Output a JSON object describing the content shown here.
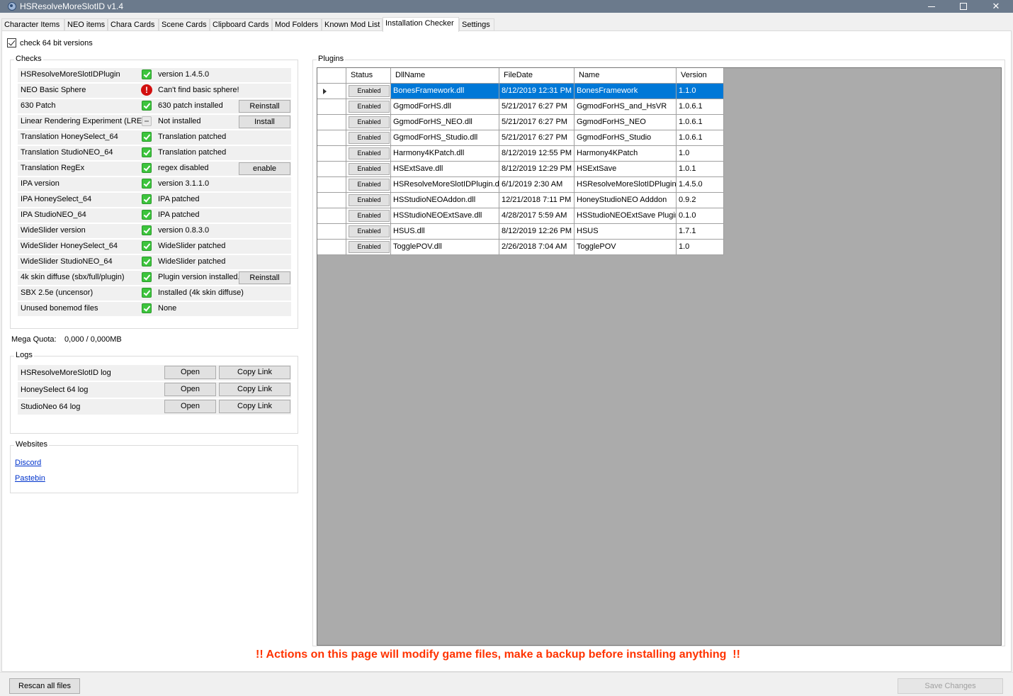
{
  "window": {
    "title": "HSResolveMoreSlotID v1.4"
  },
  "tabs": [
    {
      "label": "Character Items"
    },
    {
      "label": "NEO items"
    },
    {
      "label": "Chara Cards"
    },
    {
      "label": "Scene Cards"
    },
    {
      "label": "Clipboard Cards"
    },
    {
      "label": "Mod Folders"
    },
    {
      "label": "Known Mod List"
    },
    {
      "label": "Installation Checker",
      "active": true
    },
    {
      "label": "Settings"
    }
  ],
  "options": {
    "check64_label": "check 64 bit versions",
    "check64_checked": true
  },
  "checks": {
    "legend": "Checks",
    "rows": [
      {
        "label": "HSResolveMoreSlotIDPlugin",
        "icon": "ok",
        "status": "version 1.4.5.0"
      },
      {
        "label": "NEO Basic Sphere",
        "icon": "error",
        "status": "Can't find basic sphere!"
      },
      {
        "label": "630 Patch",
        "icon": "ok",
        "status": "630 patch installed",
        "action": "Reinstall"
      },
      {
        "label": "Linear Rendering Experiment (LRE)",
        "icon": "none",
        "status": "Not installed",
        "action": "Install"
      },
      {
        "label": "Translation HoneySelect_64",
        "icon": "ok",
        "status": "Translation patched"
      },
      {
        "label": "Translation StudioNEO_64",
        "icon": "ok",
        "status": "Translation patched"
      },
      {
        "label": "Translation RegEx",
        "icon": "ok",
        "status": "regex disabled",
        "action": "enable"
      },
      {
        "label": "IPA version",
        "icon": "ok",
        "status": "version 3.1.1.0"
      },
      {
        "label": "IPA HoneySelect_64",
        "icon": "ok",
        "status": "IPA patched"
      },
      {
        "label": "IPA StudioNEO_64",
        "icon": "ok",
        "status": "IPA patched"
      },
      {
        "label": "WideSlider version",
        "icon": "ok",
        "status": "version 0.8.3.0"
      },
      {
        "label": "WideSlider HoneySelect_64",
        "icon": "ok",
        "status": "WideSlider patched"
      },
      {
        "label": "WideSlider StudioNEO_64",
        "icon": "ok",
        "status": "WideSlider patched"
      },
      {
        "label": "4k skin diffuse (sbx/full/plugin)",
        "icon": "ok",
        "status": "Plugin version installed.",
        "action": "Reinstall"
      },
      {
        "label": "SBX 2.5e (uncensor)",
        "icon": "ok",
        "status": "Installed (4k skin diffuse)"
      },
      {
        "label": "Unused bonemod files",
        "icon": "ok",
        "status": "None"
      }
    ]
  },
  "mega_quota": {
    "label": "Mega Quota:",
    "value": "0,000 / 0,000MB"
  },
  "logs": {
    "legend": "Logs",
    "rows": [
      {
        "label": "HSResolveMoreSlotID log",
        "open": "Open",
        "copy": "Copy Link"
      },
      {
        "label": "HoneySelect 64 log",
        "open": "Open",
        "copy": "Copy Link"
      },
      {
        "label": "StudioNeo 64 log",
        "open": "Open",
        "copy": "Copy Link"
      }
    ]
  },
  "websites": {
    "legend": "Websites",
    "links": [
      {
        "label": "Discord"
      },
      {
        "label": "Pastebin"
      }
    ]
  },
  "plugins": {
    "legend": "Plugins",
    "columns": [
      "Status",
      "DllName",
      "FileDate",
      "Name",
      "Version"
    ],
    "rows": [
      {
        "status": "Enabled",
        "dll": "BonesFramework.dll",
        "date": "8/12/2019 12:31 PM",
        "name": "BonesFramework",
        "version": "1.1.0"
      },
      {
        "status": "Enabled",
        "dll": "GgmodForHS.dll",
        "date": "5/21/2017 6:27 PM",
        "name": "GgmodForHS_and_HsVR",
        "version": "1.0.6.1"
      },
      {
        "status": "Enabled",
        "dll": "GgmodForHS_NEO.dll",
        "date": "5/21/2017 6:27 PM",
        "name": "GgmodForHS_NEO",
        "version": "1.0.6.1"
      },
      {
        "status": "Enabled",
        "dll": "GgmodForHS_Studio.dll",
        "date": "5/21/2017 6:27 PM",
        "name": "GgmodForHS_Studio",
        "version": "1.0.6.1"
      },
      {
        "status": "Enabled",
        "dll": "Harmony4KPatch.dll",
        "date": "8/12/2019 12:55 PM",
        "name": "Harmony4KPatch",
        "version": "1.0"
      },
      {
        "status": "Enabled",
        "dll": "HSExtSave.dll",
        "date": "8/12/2019 12:29 PM",
        "name": "HSExtSave",
        "version": "1.0.1"
      },
      {
        "status": "Enabled",
        "dll": "HSResolveMoreSlotIDPlugin.dll",
        "date": "6/1/2019 2:30 AM",
        "name": "HSResolveMoreSlotIDPlugin",
        "version": "1.4.5.0"
      },
      {
        "status": "Enabled",
        "dll": "HSStudioNEOAddon.dll",
        "date": "12/21/2018 7:11 PM",
        "name": "HoneyStudioNEO Adddon",
        "version": "0.9.2"
      },
      {
        "status": "Enabled",
        "dll": "HSStudioNEOExtSave.dll",
        "date": "4/28/2017 5:59 AM",
        "name": "HSStudioNEOExtSave Plugin",
        "version": "0.1.0"
      },
      {
        "status": "Enabled",
        "dll": "HSUS.dll",
        "date": "8/12/2019 12:26 PM",
        "name": "HSUS",
        "version": "1.7.1"
      },
      {
        "status": "Enabled",
        "dll": "TogglePOV.dll",
        "date": "2/26/2018 7:04 AM",
        "name": "TogglePOV",
        "version": "1.0"
      }
    ]
  },
  "warning": "!! Actions on this page will modify game files, make a backup before installing anything  !!",
  "footer": {
    "rescan": "Rescan all files",
    "save": "Save Changes"
  },
  "colors": {
    "selection": "#0078d7",
    "warning": "#ff3300",
    "titlebar": "#6b7a8c"
  }
}
